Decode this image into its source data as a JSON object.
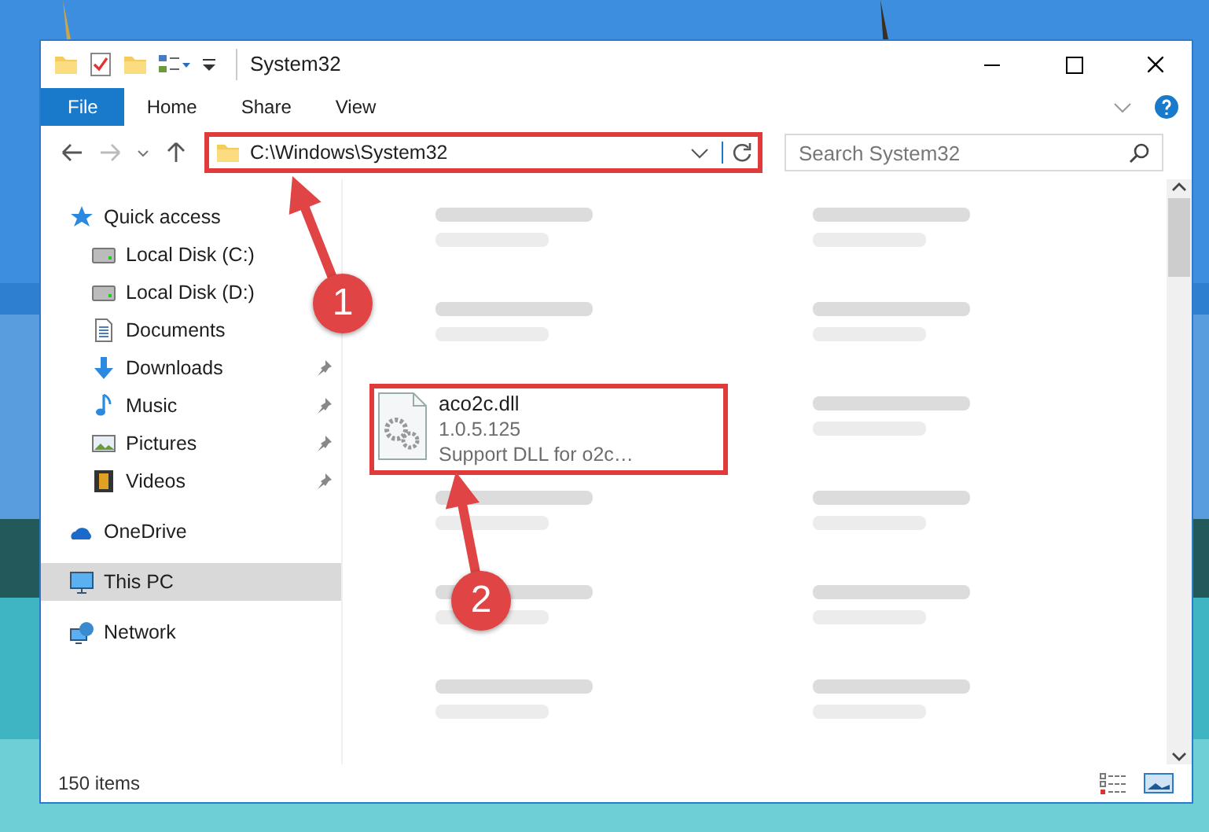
{
  "window": {
    "title": "System32"
  },
  "ribbon_tabs": [
    {
      "label": "File",
      "kind": "file"
    },
    {
      "label": "Home",
      "kind": "tab"
    },
    {
      "label": "Share",
      "kind": "tab"
    },
    {
      "label": "View",
      "kind": "tab"
    }
  ],
  "address_bar": {
    "path": "C:\\Windows\\System32",
    "highlighted": true
  },
  "search": {
    "placeholder": "Search System32"
  },
  "navigation": [
    {
      "label": "Quick access",
      "kind": "star",
      "selected": false,
      "children": [
        {
          "label": "Local Disk (C:)",
          "kind": "drive",
          "pinned": false
        },
        {
          "label": "Local Disk (D:)",
          "kind": "drive",
          "pinned": false
        },
        {
          "label": "Documents",
          "kind": "document",
          "pinned": false
        },
        {
          "label": "Downloads",
          "kind": "download",
          "pinned": true
        },
        {
          "label": "Music",
          "kind": "music",
          "pinned": true
        },
        {
          "label": "Pictures",
          "kind": "pictures",
          "pinned": true
        },
        {
          "label": "Videos",
          "kind": "videos",
          "pinned": true
        }
      ]
    },
    {
      "label": "OneDrive",
      "kind": "cloud",
      "selected": false
    },
    {
      "label": "This PC",
      "kind": "pc",
      "selected": true
    },
    {
      "label": "Network",
      "kind": "network",
      "selected": false
    }
  ],
  "files": [
    {
      "kind": "blurred"
    },
    {
      "kind": "blurred"
    },
    {
      "kind": "blurred"
    },
    {
      "kind": "blurred"
    },
    {
      "kind": "file",
      "name": "aco2c.dll",
      "lines": [
        "1.0.5.125",
        "Support DLL for o2c…"
      ],
      "highlighted": true
    },
    {
      "kind": "blurred"
    },
    {
      "kind": "blurred"
    },
    {
      "kind": "blurred"
    },
    {
      "kind": "blurred"
    },
    {
      "kind": "blurred"
    },
    {
      "kind": "blurred"
    },
    {
      "kind": "blurred"
    }
  ],
  "status_bar": {
    "text": "150 items"
  },
  "callouts": [
    {
      "number": "1"
    },
    {
      "number": "2"
    }
  ]
}
